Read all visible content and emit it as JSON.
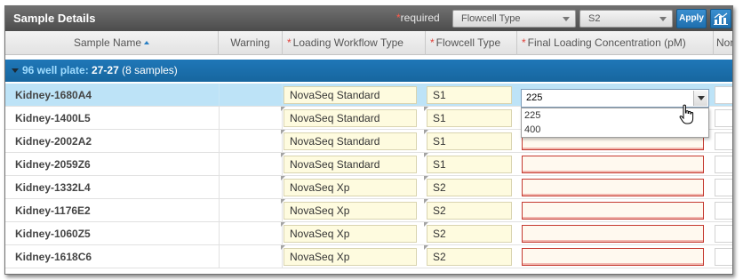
{
  "title": "Sample Details",
  "toolbar": {
    "required_star": "*",
    "required_label": "required",
    "flowcell_type_select": "Flowcell Type",
    "flowcell_value_select": "S2",
    "apply_label": "Apply",
    "chart_icon": "bar-chart-icon"
  },
  "columns": {
    "sample_name": "Sample Name",
    "warning": "Warning",
    "loading_workflow": "Loading Workflow Type",
    "flowcell_type": "Flowcell Type",
    "final_loading": "Final Loading Concentration (pM)",
    "next": "Nor"
  },
  "required_marker": "*",
  "group": {
    "title": "96 well plate:",
    "range": "27-27",
    "count": "(8 samples)"
  },
  "rows": [
    {
      "name": "Kidney-1680A4",
      "workflow": "NovaSeq Standard",
      "flowcell": "S1",
      "concentration": "225"
    },
    {
      "name": "Kidney-1400L5",
      "workflow": "NovaSeq Standard",
      "flowcell": "S1",
      "concentration": ""
    },
    {
      "name": "Kidney-2002A2",
      "workflow": "NovaSeq Standard",
      "flowcell": "S1",
      "concentration": ""
    },
    {
      "name": "Kidney-2059Z6",
      "workflow": "NovaSeq Standard",
      "flowcell": "S1",
      "concentration": ""
    },
    {
      "name": "Kidney-1332L4",
      "workflow": "NovaSeq Xp",
      "flowcell": "S2",
      "concentration": ""
    },
    {
      "name": "Kidney-1176E2",
      "workflow": "NovaSeq Xp",
      "flowcell": "S2",
      "concentration": ""
    },
    {
      "name": "Kidney-1060Z5",
      "workflow": "NovaSeq Xp",
      "flowcell": "S2",
      "concentration": ""
    },
    {
      "name": "Kidney-1618C6",
      "workflow": "NovaSeq Xp",
      "flowcell": "S2",
      "concentration": ""
    }
  ],
  "dropdown": {
    "current": "225",
    "options": [
      "225",
      "400"
    ]
  },
  "colors": {
    "group_bg": "#1f77b8",
    "selected_row": "#bde3f7",
    "field_bg": "#fefbdf",
    "invalid_border": "#c53a30",
    "accent": "#2a7fc4"
  }
}
